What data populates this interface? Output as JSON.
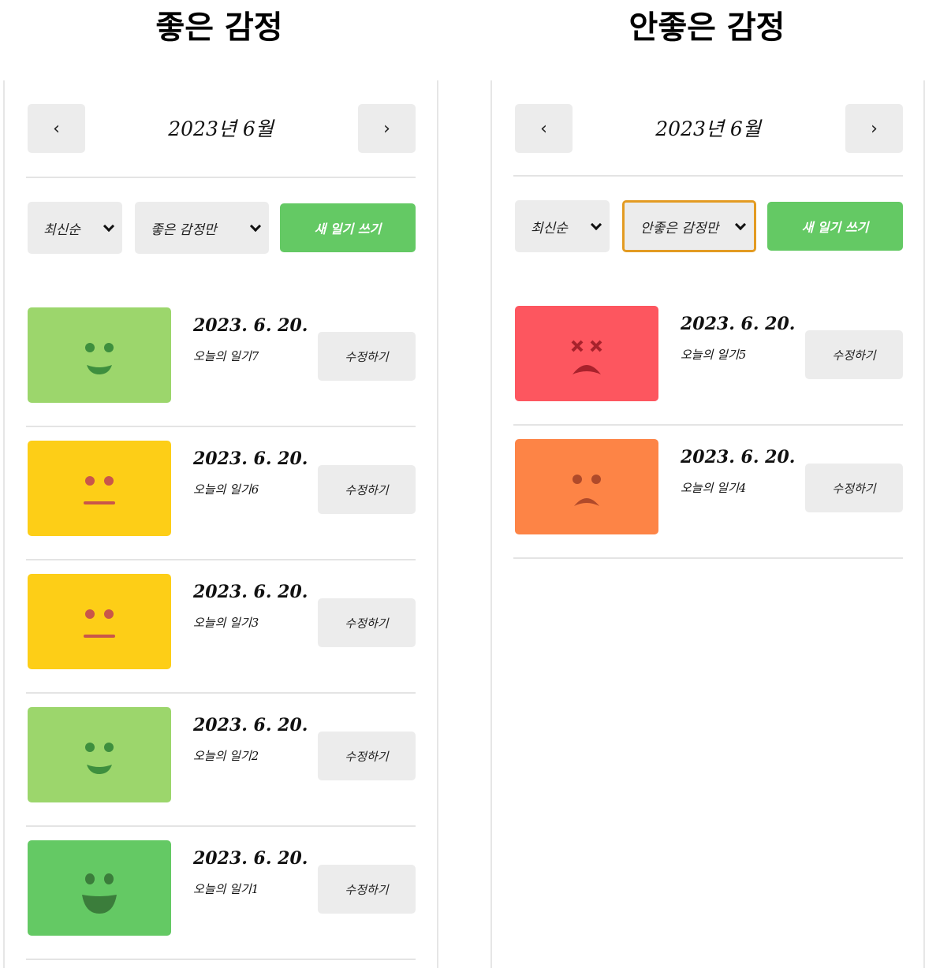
{
  "captions": {
    "left": "좋은 감정",
    "right": "안좋은 감정"
  },
  "nav": {
    "prev_icon": "‹",
    "next_icon": "›"
  },
  "left_panel": {
    "month_title": "2023년 6월",
    "sort_select": "최신순",
    "emotion_select": "좋은 감정만",
    "new_button": "새 일기 쓰기",
    "items": [
      {
        "date": "2023. 6. 20.",
        "content": "오늘의 일기7",
        "edit": "수정하기",
        "emotion": 2,
        "color": "#9cd66c"
      },
      {
        "date": "2023. 6. 20.",
        "content": "오늘의 일기6",
        "edit": "수정하기",
        "emotion": 3,
        "color": "#fdce17"
      },
      {
        "date": "2023. 6. 20.",
        "content": "오늘의 일기3",
        "edit": "수정하기",
        "emotion": 3,
        "color": "#fdce17"
      },
      {
        "date": "2023. 6. 20.",
        "content": "오늘의 일기2",
        "edit": "수정하기",
        "emotion": 2,
        "color": "#9cd66c"
      },
      {
        "date": "2023. 6. 20.",
        "content": "오늘의 일기1",
        "edit": "수정하기",
        "emotion": 1,
        "color": "#64c964"
      }
    ]
  },
  "right_panel": {
    "month_title": "2023년 6월",
    "sort_select": "최신순",
    "emotion_select": "안좋은 감정만",
    "new_button": "새 일기 쓰기",
    "items": [
      {
        "date": "2023. 6. 20.",
        "content": "오늘의 일기5",
        "edit": "수정하기",
        "emotion": 5,
        "color": "#fd565f"
      },
      {
        "date": "2023. 6. 20.",
        "content": "오늘의 일기4",
        "edit": "수정하기",
        "emotion": 4,
        "color": "#fd8446"
      }
    ]
  },
  "colors": {
    "accent_green": "#64c964",
    "focus_orange": "#e39b22",
    "button_gray": "#ececec"
  }
}
